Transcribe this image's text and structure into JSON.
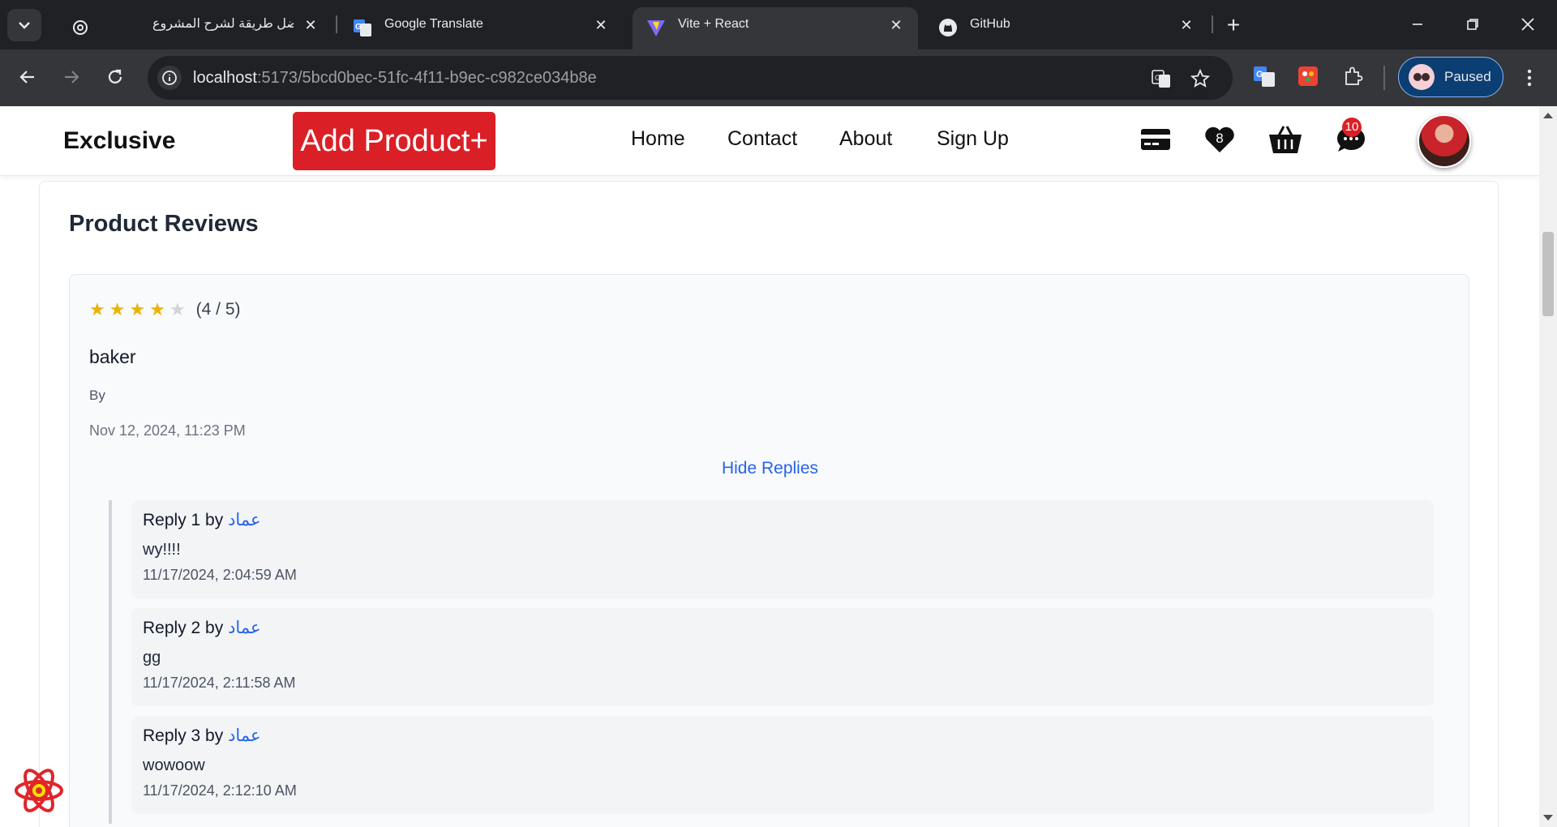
{
  "browser": {
    "tabs": [
      {
        "title": "أفضل طريقة لشرح المشروع",
        "icon": "chatgpt-icon",
        "active": false
      },
      {
        "title": "Google Translate",
        "icon": "google-translate-icon",
        "active": false
      },
      {
        "title": "Vite + React",
        "icon": "vite-icon",
        "active": true
      },
      {
        "title": "GitHub",
        "icon": "github-icon",
        "active": false
      }
    ],
    "url_host": "localhost",
    "url_path": ":5173/5bcd0bec-51fc-4f11-b9ec-c982ce034b8e",
    "profile_label": "Paused"
  },
  "header": {
    "brand": "Exclusive",
    "add_product": "Add Product+",
    "nav": [
      "Home",
      "Contact",
      "About",
      "Sign Up"
    ],
    "wishlist_count": "8",
    "messages_count": "10",
    "accent": "#db1f26"
  },
  "reviews": {
    "title": "Product Reviews",
    "rating": 4,
    "rating_max": 5,
    "rating_text": "(4 / 5)",
    "name": "baker",
    "by": "By",
    "date": "Nov 12, 2024, 11:23 PM",
    "hide_replies": "Hide Replies",
    "replies": [
      {
        "label": "Reply 1 by",
        "author": "عماد",
        "text": "wy!!!!",
        "date": "11/17/2024, 2:04:59 AM"
      },
      {
        "label": "Reply 2 by",
        "author": "عماد",
        "text": "gg",
        "date": "11/17/2024, 2:11:58 AM"
      },
      {
        "label": "Reply 3 by",
        "author": "عماد",
        "text": "wowoow",
        "date": "11/17/2024, 2:12:10 AM"
      }
    ]
  }
}
